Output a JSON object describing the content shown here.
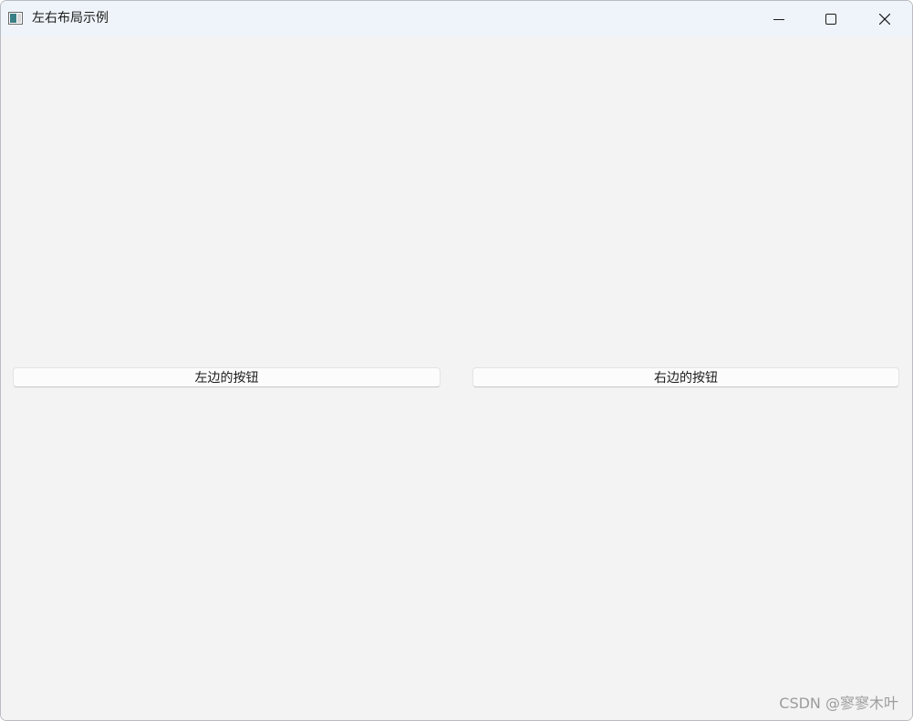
{
  "window": {
    "title": "左右布局示例"
  },
  "buttons": {
    "left_label": "左边的按钮",
    "right_label": "右边的按钮"
  },
  "watermark": {
    "text": "CSDN @寥寥木叶"
  },
  "colors": {
    "titlebar_bg": "#eef4f9",
    "client_bg": "#f3f3f3",
    "button_bg": "#fcfcfc"
  },
  "icons": {
    "app": "app-window-icon",
    "minimize": "minimize-icon",
    "maximize": "maximize-icon",
    "close": "close-icon"
  }
}
